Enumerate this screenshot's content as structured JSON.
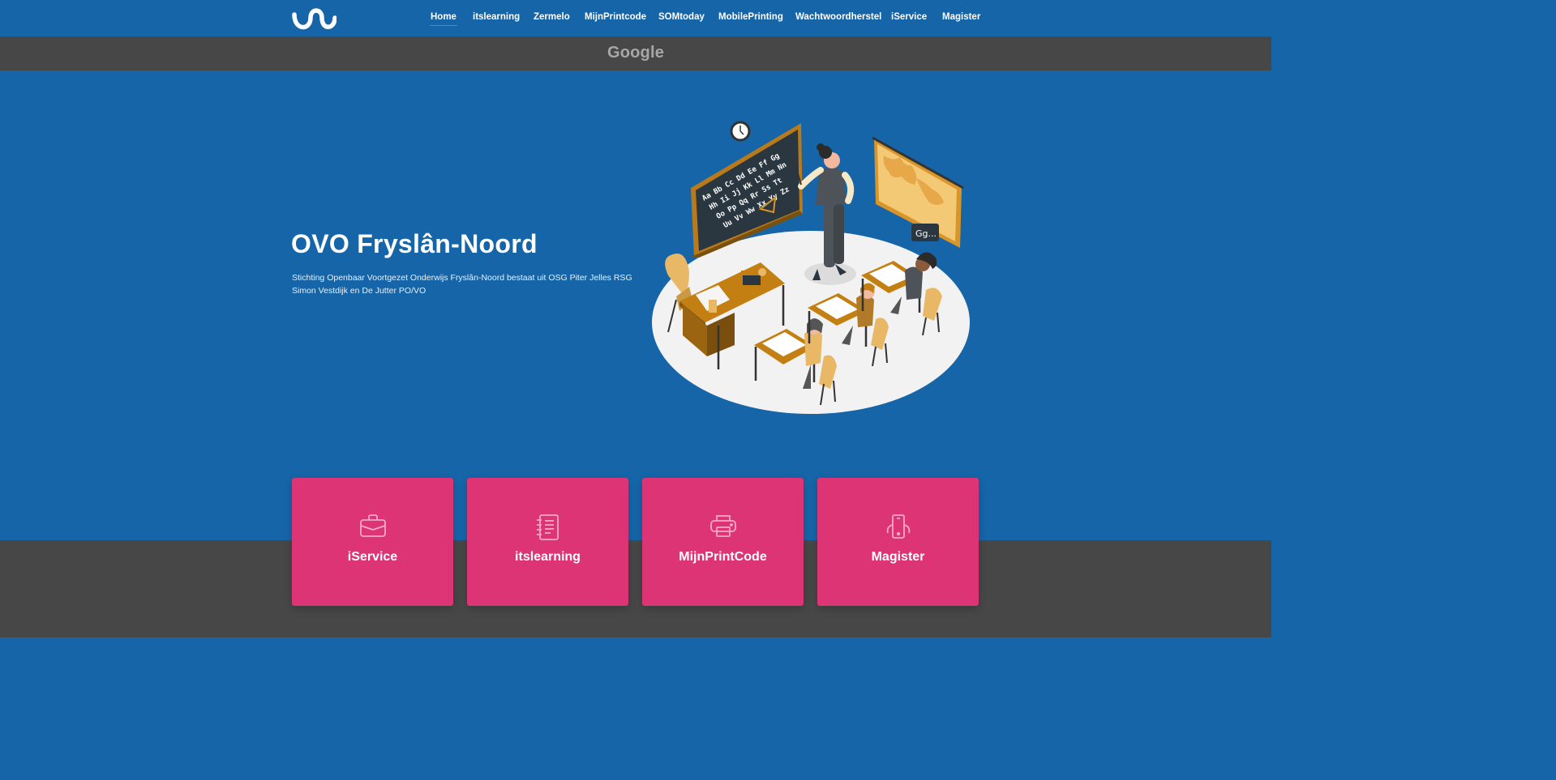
{
  "nav": {
    "items": [
      {
        "label": "Home",
        "active": true
      },
      {
        "label": "itslearning"
      },
      {
        "label": "Zermelo"
      },
      {
        "label": "MijnPrintcode"
      },
      {
        "label": "SOMtoday"
      },
      {
        "label": "MobilePrinting"
      },
      {
        "label": "Wachtwoordherstel"
      },
      {
        "label": "iService"
      },
      {
        "label": "Magister"
      }
    ]
  },
  "google_bar": {
    "text": "Google"
  },
  "hero": {
    "title": "OVO Fryslân-Noord",
    "description": "Stichting Openbaar Voortgezet Onderwijs Fryslân-Noord bestaat uit OSG Piter Jelles RSG Simon Vestdijk en De Jutter PO/VO",
    "illustration": {
      "board_letters": [
        "Aa Bb Cc Dd Ee Ff Gg",
        "Hh Ii Jj Kk Ll Mm Nn",
        "Oo Pp Qq Rr Ss Tt",
        "Uu Vv Ww Xx Yy Zz"
      ],
      "speech_text": "Gg..."
    }
  },
  "cards": [
    {
      "label": "iService",
      "icon": "briefcase-icon"
    },
    {
      "label": "itslearning",
      "icon": "notebook-icon"
    },
    {
      "label": "MijnPrintCode",
      "icon": "printer-icon"
    },
    {
      "label": "Magister",
      "icon": "phone-icon"
    }
  ],
  "colors": {
    "primary_blue": "#1565a8",
    "dark_band": "#474747",
    "card_pink": "#dc3474",
    "active_underline": "#e8478c"
  }
}
